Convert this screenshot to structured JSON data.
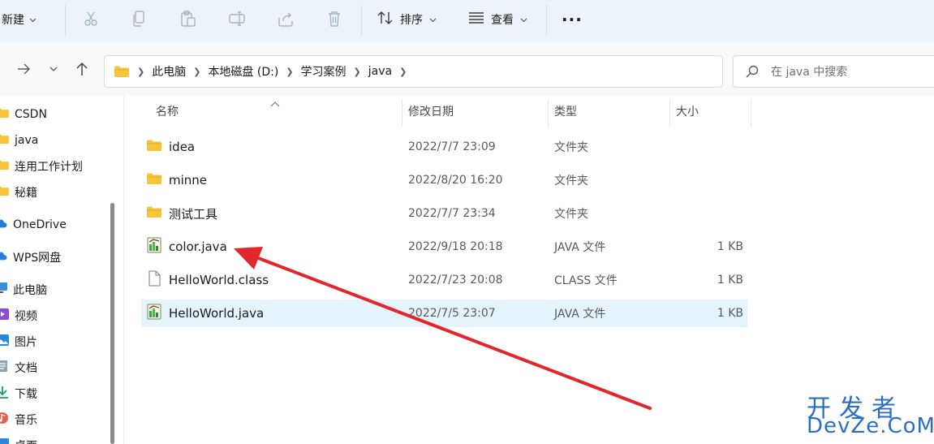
{
  "toolbar": {
    "new_label": "新建",
    "sort_label": "排序",
    "view_label": "查看",
    "more_label": "···"
  },
  "address": {
    "crumbs": [
      "此电脑",
      "本地磁盘 (D:)",
      "学习案例",
      "java"
    ]
  },
  "search": {
    "placeholder": "在 java 中搜索"
  },
  "nav": {
    "items": [
      {
        "label": "CSDN",
        "icon": "folder-icon"
      },
      {
        "label": "java",
        "icon": "folder-icon"
      },
      {
        "label": "连用工作计划",
        "icon": "folder-icon"
      },
      {
        "label": "秘籍",
        "icon": "folder-icon"
      },
      {
        "label": "OneDrive",
        "icon": "cloud-icon"
      },
      {
        "label": "WPS网盘",
        "icon": "cloud-icon"
      },
      {
        "label": "此电脑",
        "icon": "computer-icon"
      },
      {
        "label": "视频",
        "icon": "video-icon"
      },
      {
        "label": "图片",
        "icon": "picture-icon"
      },
      {
        "label": "文档",
        "icon": "document-icon"
      },
      {
        "label": "下载",
        "icon": "download-icon"
      },
      {
        "label": "音乐",
        "icon": "music-icon"
      },
      {
        "label": "桌面",
        "icon": "desktop-icon"
      }
    ]
  },
  "columns": {
    "name": "名称",
    "date": "修改日期",
    "type": "类型",
    "size": "大小"
  },
  "files": [
    {
      "name": "idea",
      "date": "2022/7/7 23:09",
      "type": "文件夹",
      "size": "",
      "icon": "folder-icon"
    },
    {
      "name": "minne",
      "date": "2022/8/20 16:20",
      "type": "文件夹",
      "size": "",
      "icon": "folder-icon"
    },
    {
      "name": "测试工具",
      "date": "2022/7/7 23:34",
      "type": "文件夹",
      "size": "",
      "icon": "folder-icon"
    },
    {
      "name": "color.java",
      "date": "2022/9/18 20:18",
      "type": "JAVA 文件",
      "size": "1 KB",
      "icon": "java-file-icon"
    },
    {
      "name": "HelloWorld.class",
      "date": "2022/7/23 20:08",
      "type": "CLASS 文件",
      "size": "1 KB",
      "icon": "blank-file-icon"
    },
    {
      "name": "HelloWorld.java",
      "date": "2022/7/5 23:07",
      "type": "JAVA 文件",
      "size": "1 KB",
      "icon": "java-file-icon"
    }
  ],
  "watermark": {
    "cn": "开发者",
    "en": "DevZe.CoM"
  },
  "colors": {
    "accent": "#0067c0",
    "selection": "#e5f3fd",
    "toolbar_bg": "#eef3f9",
    "arrow": "#e3262b",
    "folder": "#f7c43d"
  }
}
